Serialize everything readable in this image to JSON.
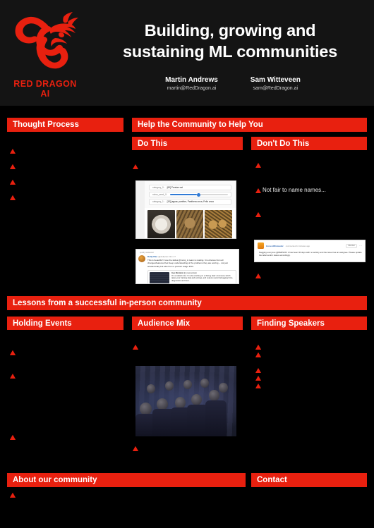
{
  "header": {
    "logo_text": "RED DRAGON AI",
    "logo_icon": "dragon-logo",
    "title_line1": "Building, growing and",
    "title_line2": "sustaining ML communities",
    "authors": [
      {
        "name": "Martin Andrews",
        "email": "martin@RedDragon.ai"
      },
      {
        "name": "Sam Witteveen",
        "email": "sam@RedDragon.ai"
      }
    ]
  },
  "sections": {
    "thought_process": {
      "title": "Thought Process"
    },
    "help_community": {
      "title": "Help the Community to Help You"
    },
    "do_this": {
      "title": "Do This"
    },
    "dont_do_this": {
      "title": "Don't Do This",
      "visible_note": "Not fair to name names..."
    },
    "lessons": {
      "title": "Lessons from a successful in-person community"
    },
    "holding_events": {
      "title": "Holding Events"
    },
    "audience_mix": {
      "title": "Audience Mix"
    },
    "finding_speakers": {
      "title": "Finding Speakers"
    },
    "about_community": {
      "title": "About our community"
    },
    "contact": {
      "title": "Contact"
    }
  },
  "figures": {
    "colab": {
      "name": "colab-notebook-screenshot",
      "rows": [
        {
          "label": "category_0:",
          "value": "[60] Persian cat"
        },
        {
          "label": "noise_seed_0:",
          "value": ""
        },
        {
          "label": "category_1:",
          "value": "[10] jaguar, panther, Panthera onca, Felis onca"
        }
      ],
      "images": [
        "persian-cat",
        "ocelot-cat",
        "jaguar-cat"
      ]
    },
    "tweet": {
      "name": "twitter-post-screenshot",
      "retweet_label": "spotify retweeted",
      "author": "Delip Rao",
      "handle": "@deliprao",
      "date": "Nov 17",
      "text": "This is beautiful! I love the slides @mccq_in team is making. It is obvious from all changes/features their deep understanding of the problems they are solving -- not just academically but also from a product usage POV.",
      "quote_author": "Ines Montani",
      "quote_handle": "@_inesmontani",
      "quote_text": "On a related note: I'm also working on a 'debug data' command, which takes your training data and settings, and outputs useful debugging hints, diagnostics and best..."
    },
    "github": {
      "name": "github-comment-screenshot",
      "user": "HonestMisleader",
      "meta": "commented 11 minutes ago",
      "badge": "Member",
      "body": "Nagging everyone @PERSON: it has been 90 days with no activity and the issue has an assignee. Please update the label and/or status accordingly."
    },
    "audience": {
      "name": "conference-audience-photo"
    }
  },
  "bullet_groups": {
    "thought_process": [
      {
        "indent": 0,
        "text": ""
      },
      {
        "indent": 0,
        "spacer": true
      },
      {
        "indent": 0,
        "spacer": true
      },
      {
        "indent": 0,
        "text": ""
      },
      {
        "indent": 0,
        "text": ""
      },
      {
        "indent": 0,
        "text": ""
      },
      {
        "indent": 0,
        "spacer": true
      },
      {
        "indent": 0,
        "spacer": true
      },
      {
        "indent": 0,
        "text": ""
      },
      {
        "indent": 0,
        "text": ""
      },
      {
        "indent": 0,
        "text": ""
      },
      {
        "indent": 0,
        "spacer": true
      },
      {
        "indent": 0,
        "spacer": true
      },
      {
        "indent": 0,
        "text": ""
      },
      {
        "indent": 0,
        "text": ""
      },
      {
        "indent": 0,
        "text": ""
      }
    ],
    "do_this_top": [
      {
        "indent": 0,
        "text": ""
      }
    ],
    "dont_top": [
      {
        "indent": 0,
        "text": ""
      }
    ],
    "dont_mid": [
      {
        "indent": 0,
        "text": "Not fair to name names...",
        "visible": true
      }
    ],
    "dont_lower": [
      {
        "indent": 0,
        "text": ""
      },
      {
        "indent": 0,
        "text": ""
      }
    ],
    "dont_bottom": [
      {
        "indent": 0,
        "text": ""
      },
      {
        "indent": 0,
        "text": ""
      }
    ],
    "holding_events": [
      {
        "indent": 0,
        "text": ""
      },
      {
        "indent": 0,
        "text": ""
      },
      {
        "indent": 0,
        "text": ""
      },
      {
        "indent": 0,
        "text": ""
      },
      {
        "indent": 0,
        "spacer": true
      },
      {
        "indent": 0,
        "spacer": true
      },
      {
        "indent": 0,
        "spacer": true
      },
      {
        "indent": 0,
        "text": ""
      }
    ],
    "holding_events_2": [
      {
        "indent": 0,
        "text": ""
      },
      {
        "indent": 0,
        "text": ""
      },
      {
        "indent": 0,
        "text": ""
      }
    ],
    "audience_mix_top": [
      {
        "indent": 0,
        "text": ""
      },
      {
        "indent": 0,
        "text": ""
      },
      {
        "indent": 0,
        "text": ""
      }
    ],
    "audience_mix_bottom": [
      {
        "indent": 0,
        "text": ""
      },
      {
        "indent": 0,
        "text": ""
      },
      {
        "indent": 0,
        "text": ""
      }
    ],
    "finding_speakers": [
      {
        "indent": 0,
        "text": ""
      },
      {
        "indent": 0,
        "text": ""
      },
      {
        "indent": 0,
        "text": ""
      },
      {
        "indent": 0,
        "spacer": true
      },
      {
        "indent": 0,
        "text": ""
      },
      {
        "indent": 0,
        "text": ""
      },
      {
        "indent": 0,
        "text": ""
      },
      {
        "indent": 0,
        "spacer": true
      },
      {
        "indent": 0,
        "spacer": true
      },
      {
        "indent": 0,
        "text": ""
      },
      {
        "indent": 0,
        "spacer": true
      },
      {
        "indent": 0,
        "text": ""
      },
      {
        "indent": 0,
        "spacer": true
      },
      {
        "indent": 0,
        "text": ""
      }
    ],
    "about_community": [
      {
        "indent": 0,
        "text": ""
      },
      {
        "indent": 0,
        "text": ""
      },
      {
        "indent": 0,
        "text": ""
      }
    ]
  },
  "colors": {
    "brand_red": "#e8200f",
    "background": "#000000",
    "header_bg": "#141414",
    "text_white": "#ffffff"
  }
}
